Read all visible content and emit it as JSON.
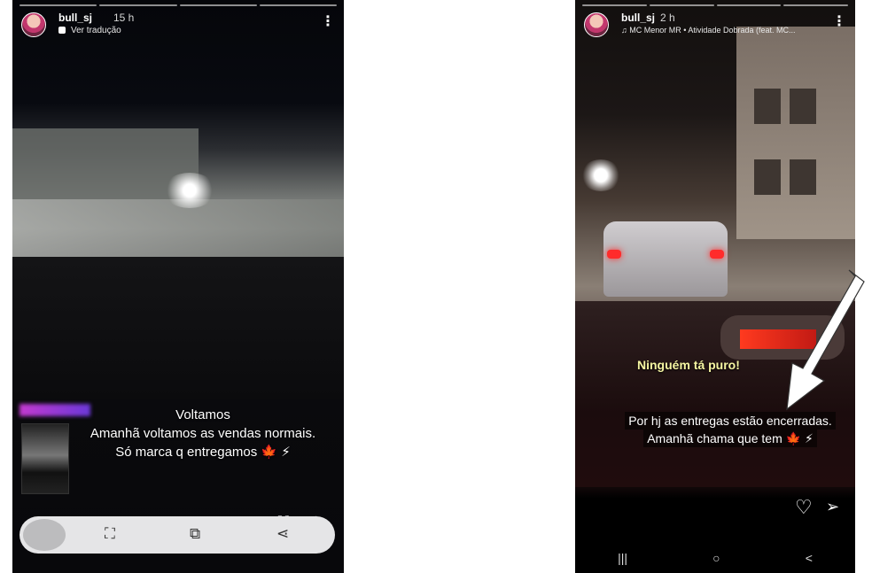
{
  "left_story": {
    "username": "bull_sj",
    "time": "15 h",
    "subline": "Ver tradução",
    "menu_icon": "⋮",
    "caption_lines": [
      "Voltamos",
      "Amanhã voltamos as vendas normais.",
      "Só marca q entregamos 🍁 ⚡"
    ],
    "bottom_icons": [
      "scan-icon",
      "edit-image-icon",
      "share-icon"
    ],
    "overlay_icons": [
      "heart-icon",
      "send-icon"
    ]
  },
  "right_story": {
    "username": "bull_sj",
    "time": "2 h",
    "music": "MC Menor MR • Atividade Dobrada (feat. MC...",
    "menu_icon": "⋮",
    "tag": "Ninguém tá puro!",
    "caption_lines": [
      "Por hj as entregas estão encerradas.",
      "Amanhã chama que tem 🍁 ⚡"
    ],
    "actions": [
      "heart-icon",
      "send-icon"
    ],
    "nav": [
      "|||",
      "○",
      "<"
    ]
  },
  "colors": {
    "arrow": "#ffffff",
    "tag_text": "#f6f6a2",
    "bottom_bar": "#e5e5e7"
  }
}
